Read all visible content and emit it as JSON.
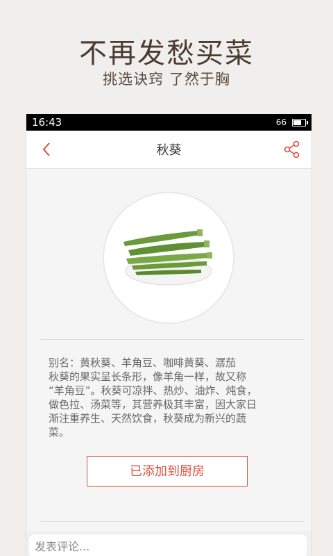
{
  "promo": {
    "title": "不再发愁买菜",
    "subtitle": "挑选诀窍 了然于胸"
  },
  "status_bar": {
    "time": "16:43",
    "battery": "66"
  },
  "header": {
    "title": "秋葵"
  },
  "detail": {
    "lines": [
      "别名：黄秋葵、羊角豆、咖啡黄葵、潺茄",
      "秋葵的果实呈长条形，像羊角一样，故又称",
      "“羊角豆”。秋葵可凉拌、热炒、油炸、炖食，",
      "做色拉、汤菜等，其营养极其丰富，因大家日",
      "渐注重养生、天然饮食，秋葵成为新兴的蔬",
      "菜。"
    ],
    "kitchen_button_label": "已添加到厨房"
  },
  "comment": {
    "placeholder": "发表评论..."
  },
  "colors": {
    "accent": "#d9503f",
    "okra_green": "#6a9a3a"
  },
  "icons": {
    "back": "chevron-left-icon",
    "share": "share-icon"
  }
}
